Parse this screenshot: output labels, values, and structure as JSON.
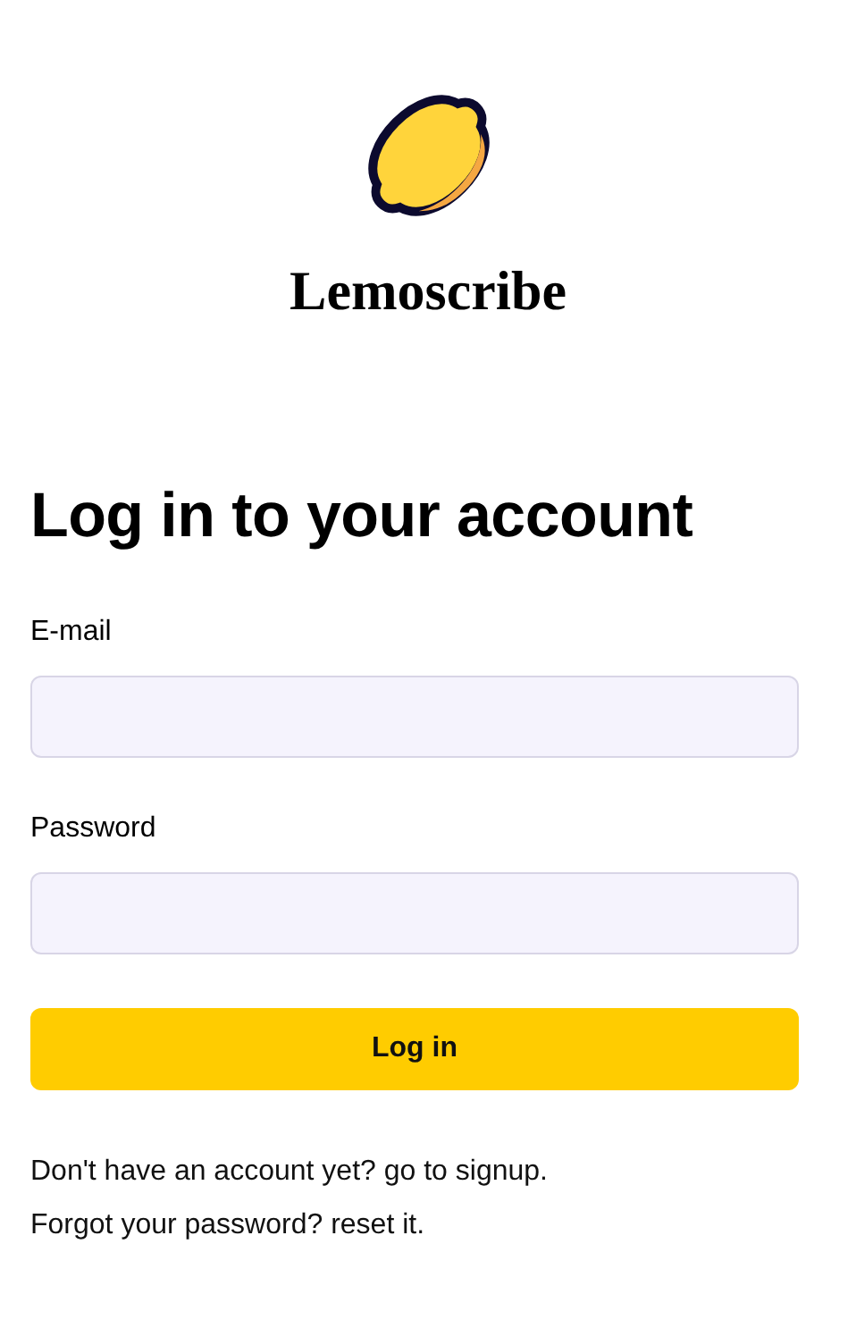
{
  "brand": {
    "name": "Lemoscribe"
  },
  "heading": "Log in to your account",
  "fields": [
    {
      "label": "E-mail"
    },
    {
      "label": "Password"
    }
  ],
  "submit": "Log in",
  "footer": [
    {
      "text": "Don't have an account yet?",
      "link": "go to signup."
    },
    {
      "text": "Forgot your password?",
      "link": "reset it."
    }
  ]
}
